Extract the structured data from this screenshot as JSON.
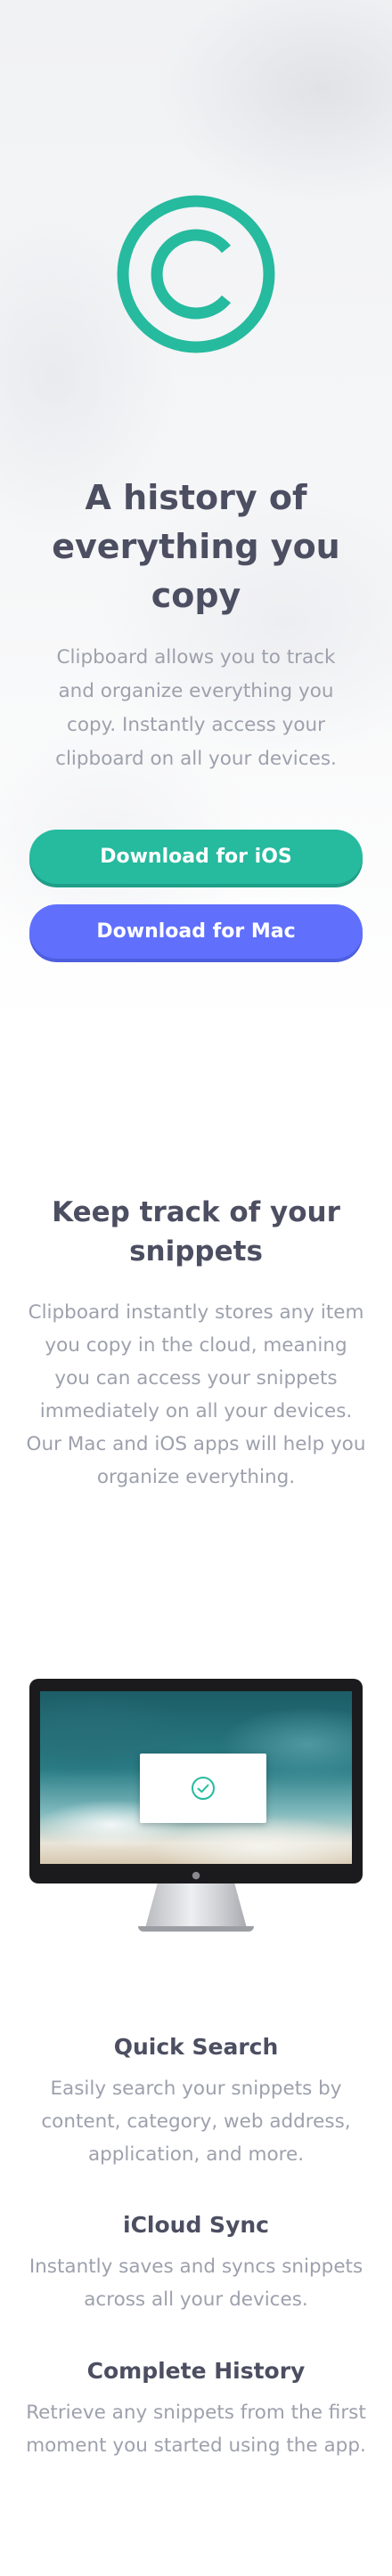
{
  "hero": {
    "title": "A history of everything you copy",
    "text": "Clipboard allows you to track and organize everything you copy. Instantly access your clipboard on all your devices.",
    "logo_icon": "copyright-circle-icon",
    "accent_color": "#26ba9f",
    "buttons": {
      "ios_label": "Download for iOS",
      "mac_label": "Download for Mac",
      "ios_color": "#26ba9f",
      "mac_color": "#6070fd"
    }
  },
  "snippets": {
    "title": "Keep track of your snippets",
    "text": "Clipboard instantly stores any item you copy in the cloud, meaning you can access your snippets immediately on all your devices. Our Mac and iOS apps will help you organize everything."
  },
  "monitor": {
    "check_icon": "check-circle-icon",
    "apple_icon": "apple-logo-icon"
  },
  "features": [
    {
      "title": "Quick Search",
      "text": "Easily search your snippets by content, category, web address, application, and more."
    },
    {
      "title": "iCloud Sync",
      "text": "Instantly saves and syncs snippets across all your devices."
    },
    {
      "title": "Complete History",
      "text": "Retrieve any snippets from the first moment you started using the app."
    }
  ]
}
